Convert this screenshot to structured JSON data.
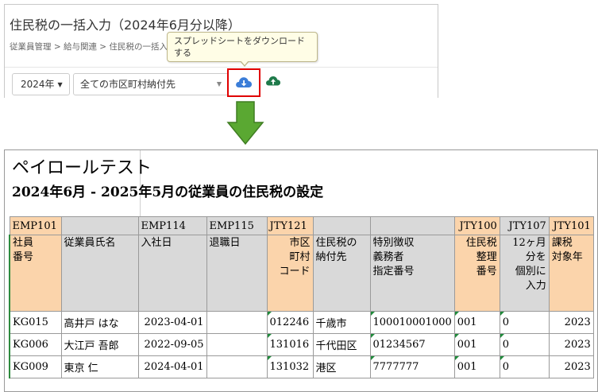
{
  "panel": {
    "title": "住民税の一括入力（2024年6月分以降）",
    "breadcrumb": "従業員管理 > 給与関連 > 住民税の一括入",
    "year_button": "2024年",
    "select_value": "全ての市区町村納付先",
    "download_icon": "cloud-download-icon",
    "upload_icon": "cloud-upload-icon",
    "accent_blue": "#3b7dd8",
    "upload_green": "#1e7a4a",
    "highlight_red": "#e00000"
  },
  "tooltip": {
    "line1": "スプレッドシートをダウンロード",
    "line2": "する"
  },
  "arrow": {
    "icon": "arrow-down-icon",
    "color": "#5aa832"
  },
  "sheet": {
    "title1": "ペイロールテスト",
    "title2": "2024年6月 - 2025年5月の従業員の住民税の設定",
    "codes": [
      "EMP101",
      "",
      "EMP114",
      "EMP115",
      "JTY121",
      "",
      "",
      "JTY100",
      "JTY107",
      "JTY101"
    ],
    "headers": [
      [
        "社員",
        "番号"
      ],
      [
        "従業員氏名"
      ],
      [
        "入社日"
      ],
      [
        "退職日"
      ],
      [
        "市区",
        "町村",
        "コード"
      ],
      [
        "住民税の",
        "納付先"
      ],
      [
        "特別徴収",
        "義務者",
        "指定番号"
      ],
      [
        "住民税",
        "整理",
        "番号"
      ],
      [
        "12ヶ月",
        "分を",
        "個別に",
        "入力"
      ],
      [
        "課税",
        "対象年"
      ]
    ],
    "rows": [
      [
        "KG015",
        "高井戸 はな",
        "2023-04-01",
        "",
        "012246",
        "千歳市",
        "100010001000",
        "001",
        "0",
        "2023"
      ],
      [
        "KG006",
        "大江戸 吾郎",
        "2022-09-05",
        "",
        "131016",
        "千代田区",
        "01234567",
        "001",
        "0",
        "2023"
      ],
      [
        "KG009",
        "東京 仁",
        "2024-04-01",
        "",
        "131032",
        "港区",
        "7777777",
        "001",
        "0",
        "2023"
      ]
    ],
    "header_orange": "#fbd4ab",
    "header_gray": "#d9d9d9"
  }
}
